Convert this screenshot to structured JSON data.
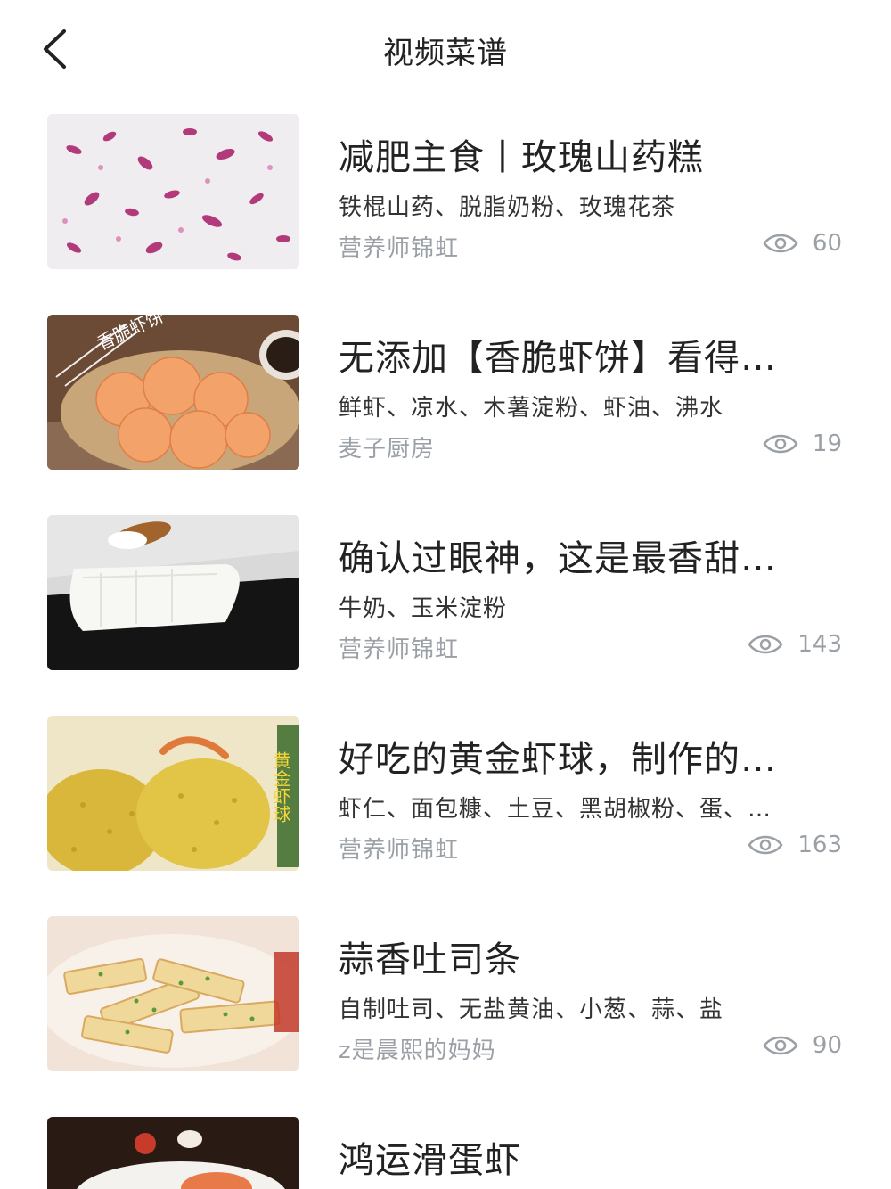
{
  "header": {
    "title": "视频菜谱",
    "back_icon": "chevron-left-icon"
  },
  "recipes": [
    {
      "title": "减肥主食丨玫瑰山药糕",
      "ingredients": "铁棍山药、脱脂奶粉、玫瑰花茶",
      "author": "营养师锦虹",
      "views": "60"
    },
    {
      "title": "无添加【香脆虾饼】看得…",
      "ingredients": "鲜虾、凉水、木薯淀粉、虾油、沸水",
      "author": "麦子厨房",
      "views": "19",
      "thumb_text": "香脆虾饼"
    },
    {
      "title": "确认过眼神，这是最香甜…",
      "ingredients": "牛奶、玉米淀粉",
      "author": "营养师锦虹",
      "views": "143"
    },
    {
      "title": "好吃的黄金虾球，制作的…",
      "ingredients": "虾仁、面包糠、土豆、黑胡椒粉、蛋、…",
      "author": "营养师锦虹",
      "views": "163",
      "thumb_text": "黄金虾球"
    },
    {
      "title": "蒜香吐司条",
      "ingredients": "自制吐司、无盐黄油、小葱、蒜、盐",
      "author": "z是晨熙的妈妈",
      "views": "90"
    },
    {
      "title": "鸿运滑蛋虾",
      "ingredients": "",
      "author": "",
      "views": ""
    }
  ],
  "colors": {
    "text_primary": "#222222",
    "text_secondary": "#333333",
    "text_muted": "#9aa0a6",
    "background": "#ffffff"
  },
  "icons": {
    "views_icon": "eye-icon"
  }
}
